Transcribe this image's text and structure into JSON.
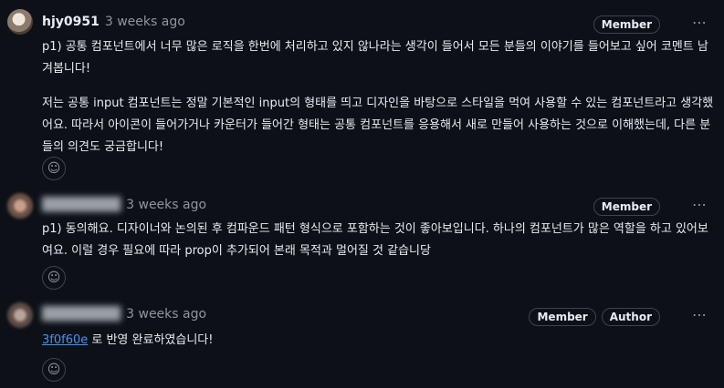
{
  "comments": [
    {
      "author": "hjy0951",
      "time": "3 weeks ago",
      "badges": [
        "Member"
      ],
      "more_icon": "kebab-horizontal-icon",
      "paragraphs": [
        "p1) 공통 컴포넌트에서 너무 많은 로직을 한번에 처리하고 있지 않나라는 생각이 들어서 모든 분들의 이야기를 들어보고 싶어 코멘트 남겨봅니다!",
        "저는 공통 input 컴포넌트는 정말 기본적인 input의 형태를 띄고 디자인을 바탕으로 스타일을 먹여 사용할 수 있는 컴포넌트라고 생각했어요. 따라서 아이콘이 들어가거나 카운터가 들어간 형태는 공통 컴포넌트를 응용해서 새로 만들어 사용하는 것으로 이해했는데, 다른 분들의 의견도 궁금합니다!"
      ]
    },
    {
      "author": "",
      "time": "3 weeks ago",
      "badges": [
        "Member"
      ],
      "paragraphs": [
        "p1) 동의해요. 디자이너와 논의된 후 컴파운드 패턴 형식으로 포함하는 것이 좋아보입니다. 하나의 컴포넌트가 많은 역할을 하고 있어보여요. 이럴 경우 필요에 따라 prop이 추가되어 본래 목적과 멀어질 것 같습니당"
      ]
    },
    {
      "author": "",
      "time": "3 weeks ago",
      "badges": [
        "Member",
        "Author"
      ],
      "commit_link": "3f0f60e",
      "text_after_link": " 로 반영 완료하였습니다!"
    }
  ],
  "icons": {
    "more": "⋯",
    "reaction": "☺"
  }
}
